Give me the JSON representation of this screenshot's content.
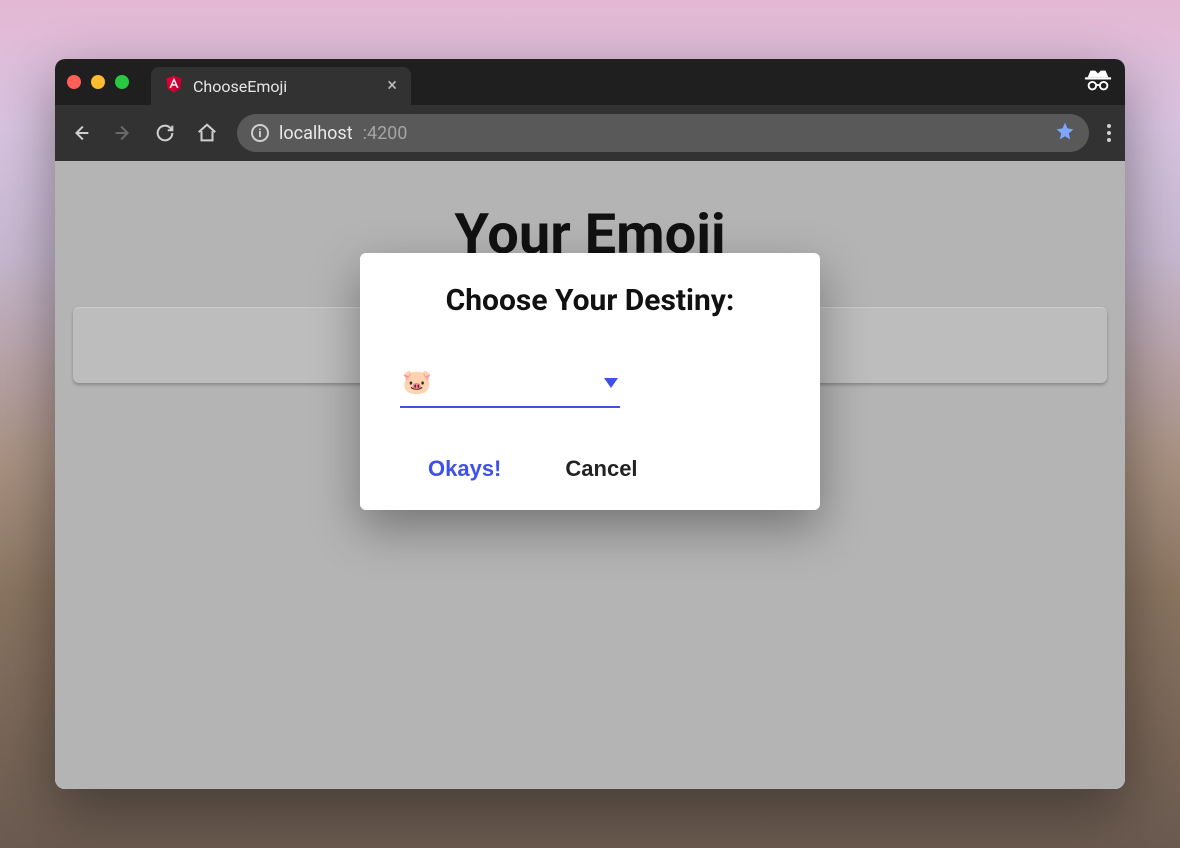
{
  "browser": {
    "tab_title": "ChooseEmoji",
    "url_host": "localhost",
    "url_port": ":4200"
  },
  "page": {
    "title": "Your Emoji"
  },
  "dialog": {
    "title": "Choose Your Destiny:",
    "selected_emoji": "🐷",
    "ok_label": "Okays!",
    "cancel_label": "Cancel"
  },
  "icons": {
    "angular": "angular-icon",
    "incognito": "incognito-icon"
  },
  "colors": {
    "accent": "#3f51e6",
    "window_dark": "#323232"
  }
}
